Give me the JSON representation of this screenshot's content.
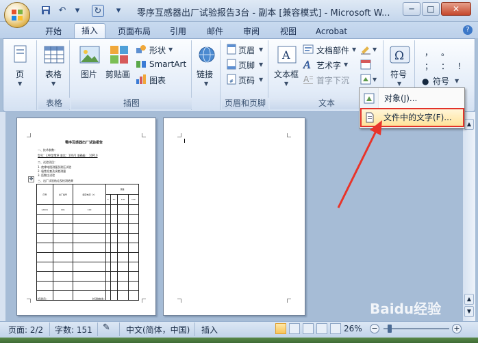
{
  "window": {
    "title": "零序互感器出厂试验报告3台 - 副本 [兼容模式] - Microsoft W...",
    "min": "─",
    "restore": "□",
    "close": "✕"
  },
  "qat": [
    "save-icon",
    "undo-icon",
    "redo-icon",
    "customize-icon"
  ],
  "tabs": [
    "开始",
    "插入",
    "页面布局",
    "引用",
    "邮件",
    "审阅",
    "视图",
    "Acrobat"
  ],
  "ribbon": {
    "pages": {
      "label": "页",
      "group": ""
    },
    "tables": {
      "label": "表格",
      "group": "表格"
    },
    "illustrations": {
      "picture": "图片",
      "clipart": "剪贴画",
      "shapes": "形状",
      "smartart": "SmartArt",
      "chart": "图表",
      "group": "插图"
    },
    "links": {
      "label": "链接"
    },
    "header_footer": {
      "header": "页眉",
      "footer": "页脚",
      "page_number": "页码",
      "group": "页眉和页脚"
    },
    "text": {
      "textbox": "文本框",
      "quickparts": "文档部件",
      "wordart": "艺术字",
      "dropcap": "首字下沉",
      "group": "文本"
    },
    "symbols": {
      "symbol_big": "符号",
      "symbol_small": "符号",
      "chars": [
        "，",
        "。",
        "；",
        "：",
        "！",
        "？"
      ]
    }
  },
  "menu": {
    "object": "对象(J)...",
    "text_from_file": "文件中的文字(F)..."
  },
  "doc": {
    "heading": "零序互感器出厂试验报告",
    "lines": [
      "一、技术参数：",
      "型号：LXK型零序   变比：100/1   准确级：  10P10",
      "二、试验项目：",
      "1. 绝缘电阻测量及耐压试验",
      "2. 极性检查及误差测量",
      "3. 匝数比试验",
      "三、出厂试验结论及检测结果"
    ],
    "table_headers": [
      "序号",
      "出厂编号",
      "额定电流（A）",
      "误差"
    ],
    "table_sub": [
      "5",
      "20",
      "100",
      "120"
    ],
    "table_row1": [
      "LX001",
      "001",
      "100",
      "-",
      "-",
      "-",
      "-"
    ],
    "sign": [
      "检测员：",
      "检测审核："
    ]
  },
  "status": {
    "page": "页面: 2/2",
    "words": "字数: 151",
    "lang": "中文(简体，中国)",
    "mode": "插入",
    "zoom": "26%"
  },
  "watermark": "Baidu经验"
}
